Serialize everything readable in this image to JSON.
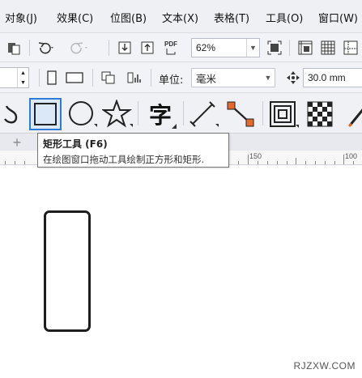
{
  "menu": {
    "items": [
      "对象(J)",
      "效果(C)",
      "位图(B)",
      "文本(X)",
      "表格(T)",
      "工具(O)",
      "窗口(W)"
    ]
  },
  "toolbar1": {
    "zoom_value": "62%",
    "pdf_label": "PDF"
  },
  "toolbar2": {
    "unit_label": "单位:",
    "unit_value": "毫米",
    "nudge_value": "30.0 mm"
  },
  "toolbox": {
    "text_tool_glyph": "字"
  },
  "tooltip": {
    "title": "矩形工具 (F6)",
    "description": "在绘图窗口拖动工具绘制正方形和矩形."
  },
  "ruler": {
    "labels": [
      "150",
      "100"
    ]
  },
  "tabstrip": {
    "add_tab": "+"
  },
  "watermark": "RJZXW.COM",
  "colors": {
    "accent": "#2f7bd6",
    "menubar_bg": "#eef0f4",
    "toolbar_bg": "#f2f3f6",
    "orange": "#e8672a"
  }
}
